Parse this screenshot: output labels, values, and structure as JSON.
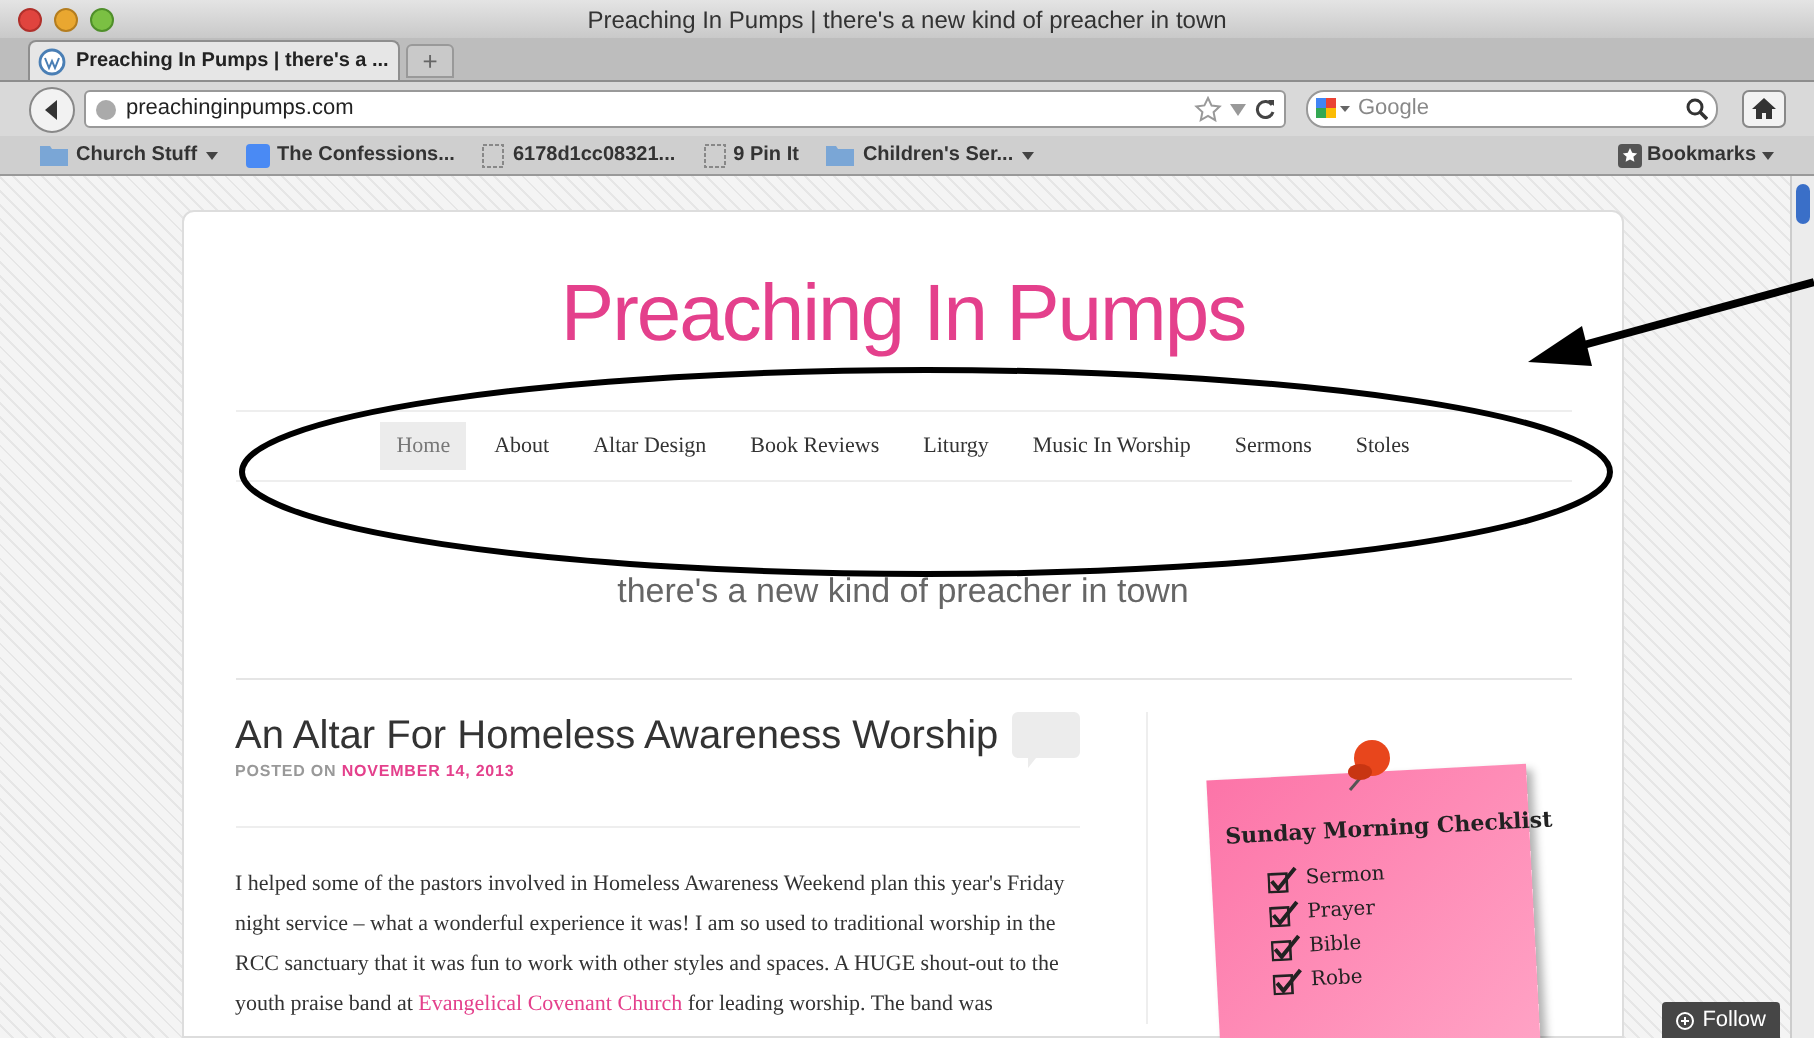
{
  "window": {
    "title": "Preaching In Pumps | there's a new kind of preacher in town"
  },
  "tabs": [
    {
      "label": "Preaching In Pumps | there's a ...",
      "selected": true
    }
  ],
  "new_tab": "+",
  "address_bar": {
    "value": "preachinginpumps.com"
  },
  "search": {
    "placeholder": "Google"
  },
  "bookmarks": [
    {
      "label": "Church Stuff",
      "kind": "folder",
      "menu": true
    },
    {
      "label": "The Confessions...",
      "kind": "site",
      "menu": false
    },
    {
      "label": "6178d1cc08321...",
      "kind": "page",
      "menu": false
    },
    {
      "label": "9 Pin It",
      "kind": "page",
      "menu": false
    },
    {
      "label": "Children's Ser...",
      "kind": "folder",
      "menu": true
    }
  ],
  "bookmarks_menu": "Bookmarks",
  "site": {
    "title": "Preaching In Pumps",
    "tagline": "there's a new kind of preacher in town",
    "nav": [
      {
        "label": "Home",
        "selected": true
      },
      {
        "label": "About",
        "selected": false
      },
      {
        "label": "Altar Design",
        "selected": false
      },
      {
        "label": "Book Reviews",
        "selected": false
      },
      {
        "label": "Liturgy",
        "selected": false
      },
      {
        "label": "Music In Worship",
        "selected": false
      },
      {
        "label": "Sermons",
        "selected": false
      },
      {
        "label": "Stoles",
        "selected": false
      }
    ]
  },
  "post": {
    "title": "An Altar For Homeless Awareness Worship",
    "posted_on": "POSTED ON",
    "date": "NOVEMBER 14, 2013",
    "body_before_link": "I helped some of the pastors involved in Homeless Awareness Weekend plan this year's Friday night service – what a wonderful experience it was!  I am so used to traditional worship in the RCC sanctuary that it was fun to work with other styles and spaces.  A HUGE shout-out to the youth praise band at",
    "link": "Evangelical Covenant Church",
    "body_after_link": "for leading worship.  The band was"
  },
  "sticky_note": {
    "title": "Sunday Morning Checklist",
    "items": [
      {
        "label": "Sermon",
        "checked": true
      },
      {
        "label": "Prayer",
        "checked": true
      },
      {
        "label": "Bible",
        "checked": true
      },
      {
        "label": "Robe",
        "checked": true
      }
    ]
  },
  "follow_button": "Follow"
}
